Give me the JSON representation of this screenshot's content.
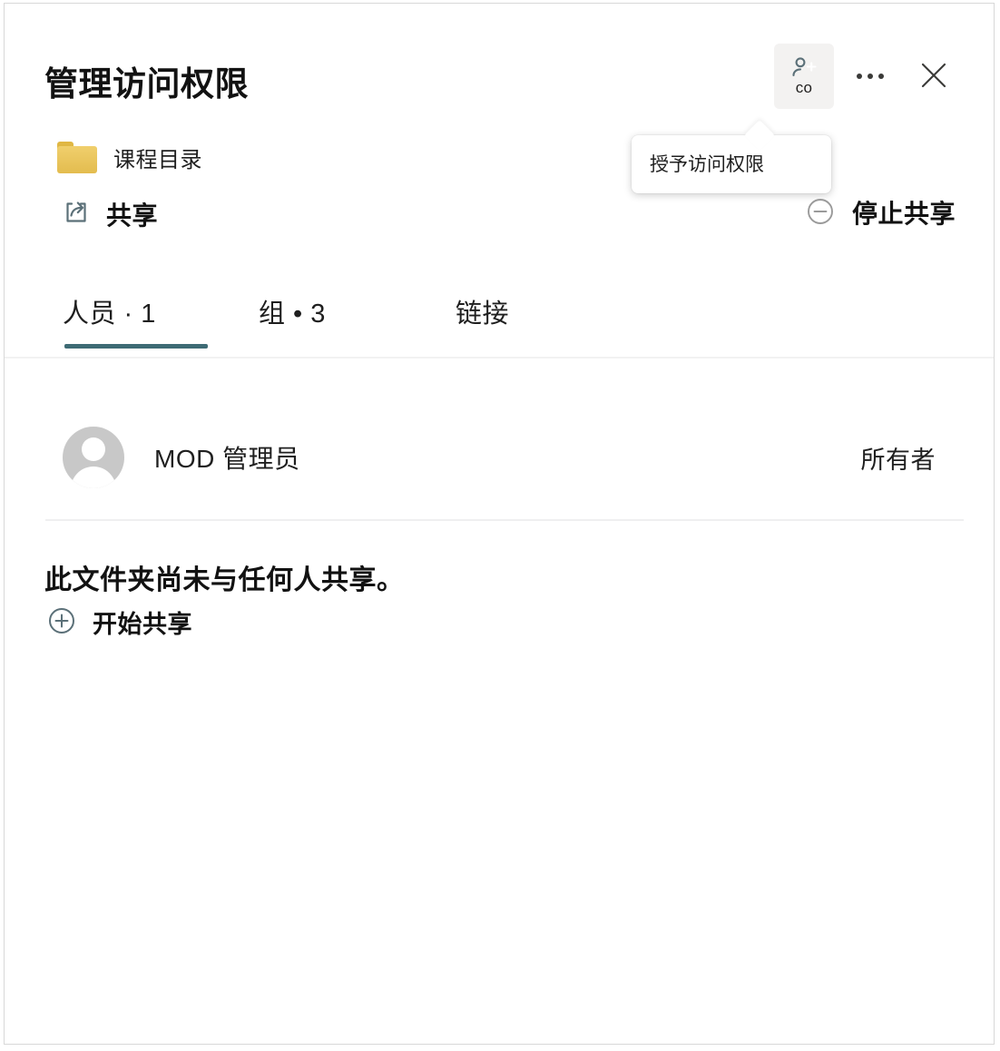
{
  "dialog": {
    "title": "管理访问权限"
  },
  "header": {
    "grant_access_button": {
      "sub_label": "co",
      "icon": "person-add-icon",
      "tooltip": "授予访问权限"
    },
    "more_options_icon": "ellipsis-icon",
    "close_icon": "close-icon"
  },
  "file": {
    "icon": "folder-icon",
    "name": "课程目录"
  },
  "share_status": {
    "icon": "share-icon",
    "label": "共享",
    "stop_sharing": {
      "icon": "circle-minus-icon",
      "label": "停止共享"
    }
  },
  "tabs": [
    {
      "label": "人员 · 1",
      "active": true
    },
    {
      "label": "组 • 3",
      "active": false
    },
    {
      "label": "链接",
      "active": false
    }
  ],
  "people": [
    {
      "avatar": "default-avatar-icon",
      "name": "MOD 管理员",
      "role": "所有者"
    }
  ],
  "empty_state": {
    "message": "此文件夹尚未与任何人共享。",
    "action": {
      "icon": "circle-plus-icon",
      "label": "开始共享"
    }
  },
  "colors": {
    "accent": "#3e6b75",
    "icon_slate": "#5b7078",
    "folder_gold": "#e3bc4f",
    "avatar_gray": "#c8c8c8",
    "text_primary": "#121212",
    "button_hover_bg": "#f3f2f1"
  }
}
